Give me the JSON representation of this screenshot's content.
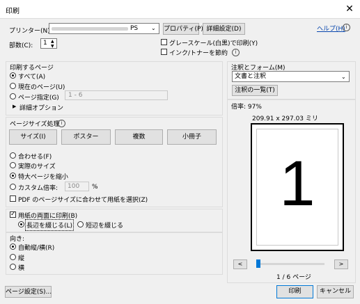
{
  "window": {
    "title": "印刷",
    "close_glyph": "✕"
  },
  "printer": {
    "label": "プリンター(N):",
    "value_suffix": "PS",
    "properties_btn": "プロパティ(P)",
    "advanced_btn": "詳細設定(D)",
    "help_link": "ヘルプ(H)",
    "copies_label": "部数(C):",
    "copies_value": "1",
    "grayscale_label": "グレースケール(白黒)で印刷(Y)",
    "ink_save_label": "インク/トナーを節約"
  },
  "pages": {
    "heading": "印刷するページ",
    "all": "すべて(A)",
    "current": "現在のページ(U)",
    "range_label": "ページ指定(G)",
    "range_value": "1 - 6",
    "more_options": "詳細オプション",
    "more_glyph": "▶"
  },
  "sizing": {
    "heading": "ページサイズ処理",
    "tabs": [
      "サイズ(I)",
      "ポスター",
      "複数",
      "小冊子"
    ],
    "fit": "合わせる(F)",
    "actual": "実際のサイズ",
    "shrink": "特大ページを縮小",
    "custom": "カスタム倍率:",
    "custom_value": "100",
    "percent": "%",
    "choose_paper": "PDF のページサイズに合わせて用紙を選択(Z)"
  },
  "duplex": {
    "label": "用紙の両面に印刷(B)",
    "long_edge": "長辺を綴じる(L)",
    "short_edge": "短辺を綴じる"
  },
  "orientation": {
    "heading": "向き:",
    "auto": "自動縦/横(R)",
    "portrait": "縦",
    "landscape": "横"
  },
  "comments": {
    "heading": "注釈とフォーム(M)",
    "selected": "文書と注釈",
    "summarize_btn": "注釈の一覧(T)"
  },
  "preview": {
    "zoom": "倍率: 97%",
    "dimensions": "209.91 x 297.03 ミリ",
    "page_number": "1",
    "page_indicator": "1 / 6 ページ",
    "slider_fraction": 0.0,
    "prev": "<",
    "next": ">"
  },
  "footer": {
    "page_setup": "ページ設定(S)...",
    "print": "印刷",
    "cancel": "キャンセル"
  }
}
